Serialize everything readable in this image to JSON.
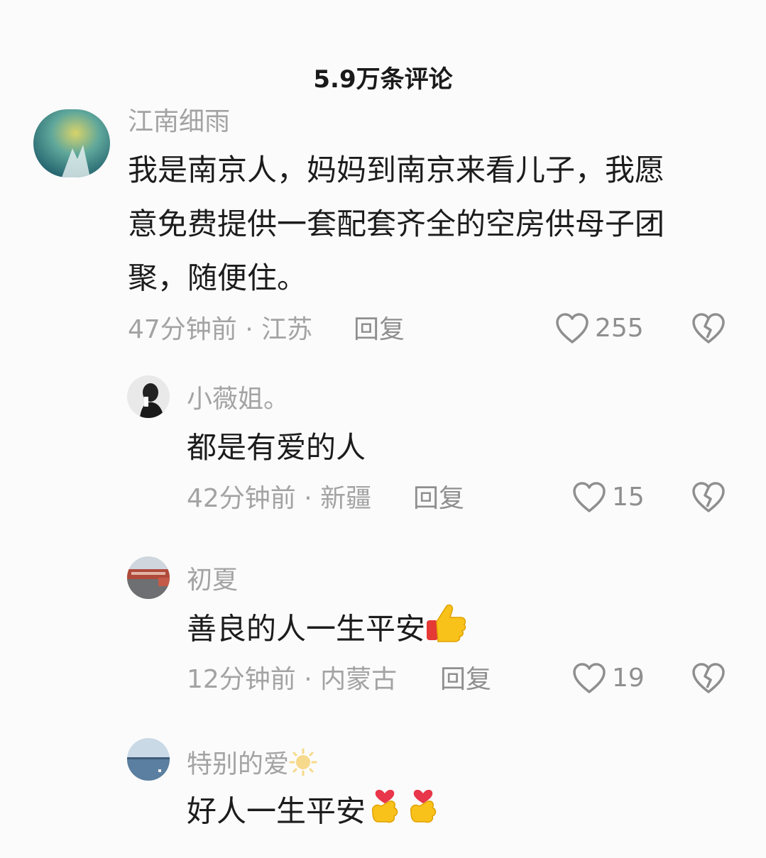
{
  "header": {
    "title": "5.9万条评论"
  },
  "comments": [
    {
      "user": "江南细雨",
      "text_lines": [
        "我是南京人，妈妈到南京来看儿子，我愿",
        "意免费提供一套配套齐全的空房供母子团",
        "聚，随便住。"
      ],
      "meta": "47分钟前 · 江苏",
      "reply_label": "回复",
      "likes": "255",
      "avatar_icon": "landscape-avatar-icon"
    }
  ],
  "replies": [
    {
      "user": "小薇姐。",
      "text": "都是有爱的人",
      "meta": "42分钟前 · 新疆",
      "reply_label": "回复",
      "likes": "15"
    },
    {
      "user": "初夏",
      "text": "善良的人一生平安",
      "emoji": "thumbs-up-icon",
      "meta": "12分钟前 · 内蒙古",
      "reply_label": "回复",
      "likes": "19"
    },
    {
      "user": "特别的爱",
      "user_emoji": "sun-icon",
      "text": "好人一生平安",
      "emoji": "finger-heart-icon"
    }
  ],
  "colors": {
    "background": "#fbfbfb",
    "username": "#a3a3a3",
    "text": "#1c1c1c",
    "action": "#8f8f8f"
  }
}
